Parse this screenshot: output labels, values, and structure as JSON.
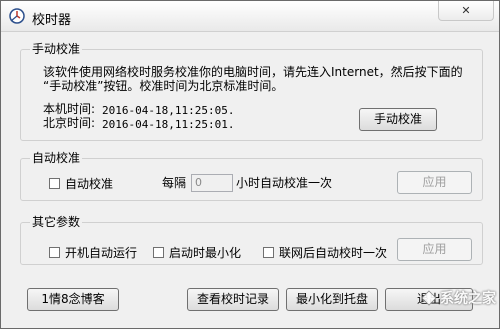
{
  "window": {
    "title": "校时器",
    "close_symbol": "✕"
  },
  "manual": {
    "legend": "手动校准",
    "desc_line1": "该软件使用网络校时服务校准你的电脑时间，请先连入Internet，然后按下面的",
    "desc_line2": "“手动校准”按钮。校准时间为北京标准时间。",
    "local_label": "本机时间:",
    "local_value": "2016-04-18,11:25:05.",
    "beijing_label": "北京时间:",
    "beijing_value": "2016-04-18,11:25:01.",
    "button_label": "手动校准"
  },
  "auto": {
    "legend": "自动校准",
    "checkbox_label": "自动校准",
    "every_label": "每隔",
    "interval_value": "0",
    "suffix_label": "小时自动校准一次",
    "apply_label": "应用"
  },
  "other": {
    "legend": "其它参数",
    "opt1_label": "开机自动运行",
    "opt2_label": "启动时最小化",
    "opt3_label": "联网后自动校时一次",
    "apply_label": "应用"
  },
  "footer": {
    "blog_label": "1情8念博客",
    "log_label": "查看校时记录",
    "minimize_label": "最小化到托盘",
    "exit_label": "退出"
  },
  "watermark": {
    "text": "系统之家"
  },
  "colors": {
    "border": "#d0d0d0",
    "window_bg": "#f0f0f0",
    "disabled_text": "#a0a0a0"
  }
}
